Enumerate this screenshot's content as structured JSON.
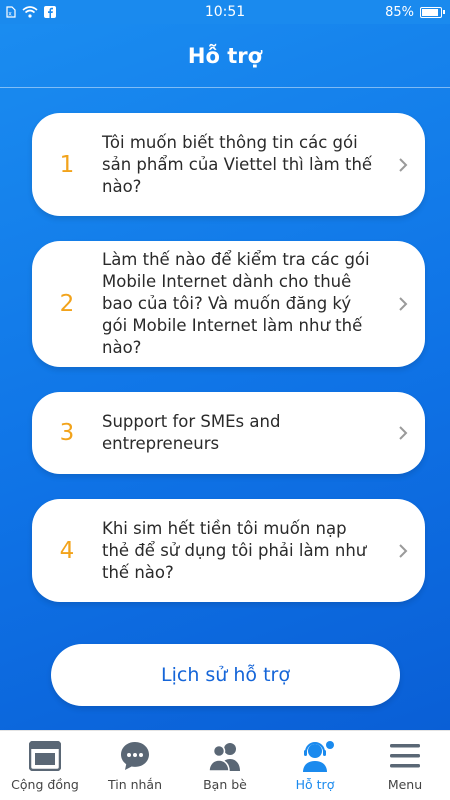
{
  "status_bar": {
    "time": "10:51",
    "battery": "85%"
  },
  "header": {
    "title": "Hỗ trợ"
  },
  "questions": [
    {
      "number": "1",
      "text": "Tôi muốn biết thông tin các gói sản phẩm của Viettel thì làm thế nào?"
    },
    {
      "number": "2",
      "text": "Làm thế nào để kiểm tra các gói Mobile Internet dành cho thuê bao của tôi? Và muốn đăng ký gói Mobile Internet làm như thế nào?"
    },
    {
      "number": "3",
      "text": "Support for SMEs and entrepreneurs"
    },
    {
      "number": "4",
      "text": "Khi sim hết tiền tôi muốn nạp thẻ để sử dụng tôi phải làm như thế nào?"
    }
  ],
  "history_button": "Lịch sử hỗ trợ",
  "tabs": [
    {
      "label": "Cộng đồng",
      "icon": "community-icon"
    },
    {
      "label": "Tin nhắn",
      "icon": "chat-bubble-icon"
    },
    {
      "label": "Bạn bè",
      "icon": "friends-icon"
    },
    {
      "label": "Hỗ trợ",
      "icon": "support-agent-icon"
    },
    {
      "label": "Menu",
      "icon": "hamburger-menu-icon"
    }
  ],
  "colors": {
    "primary_blue": "#1a8aee",
    "number_orange": "#f2a31b",
    "history_text": "#1565d8"
  }
}
